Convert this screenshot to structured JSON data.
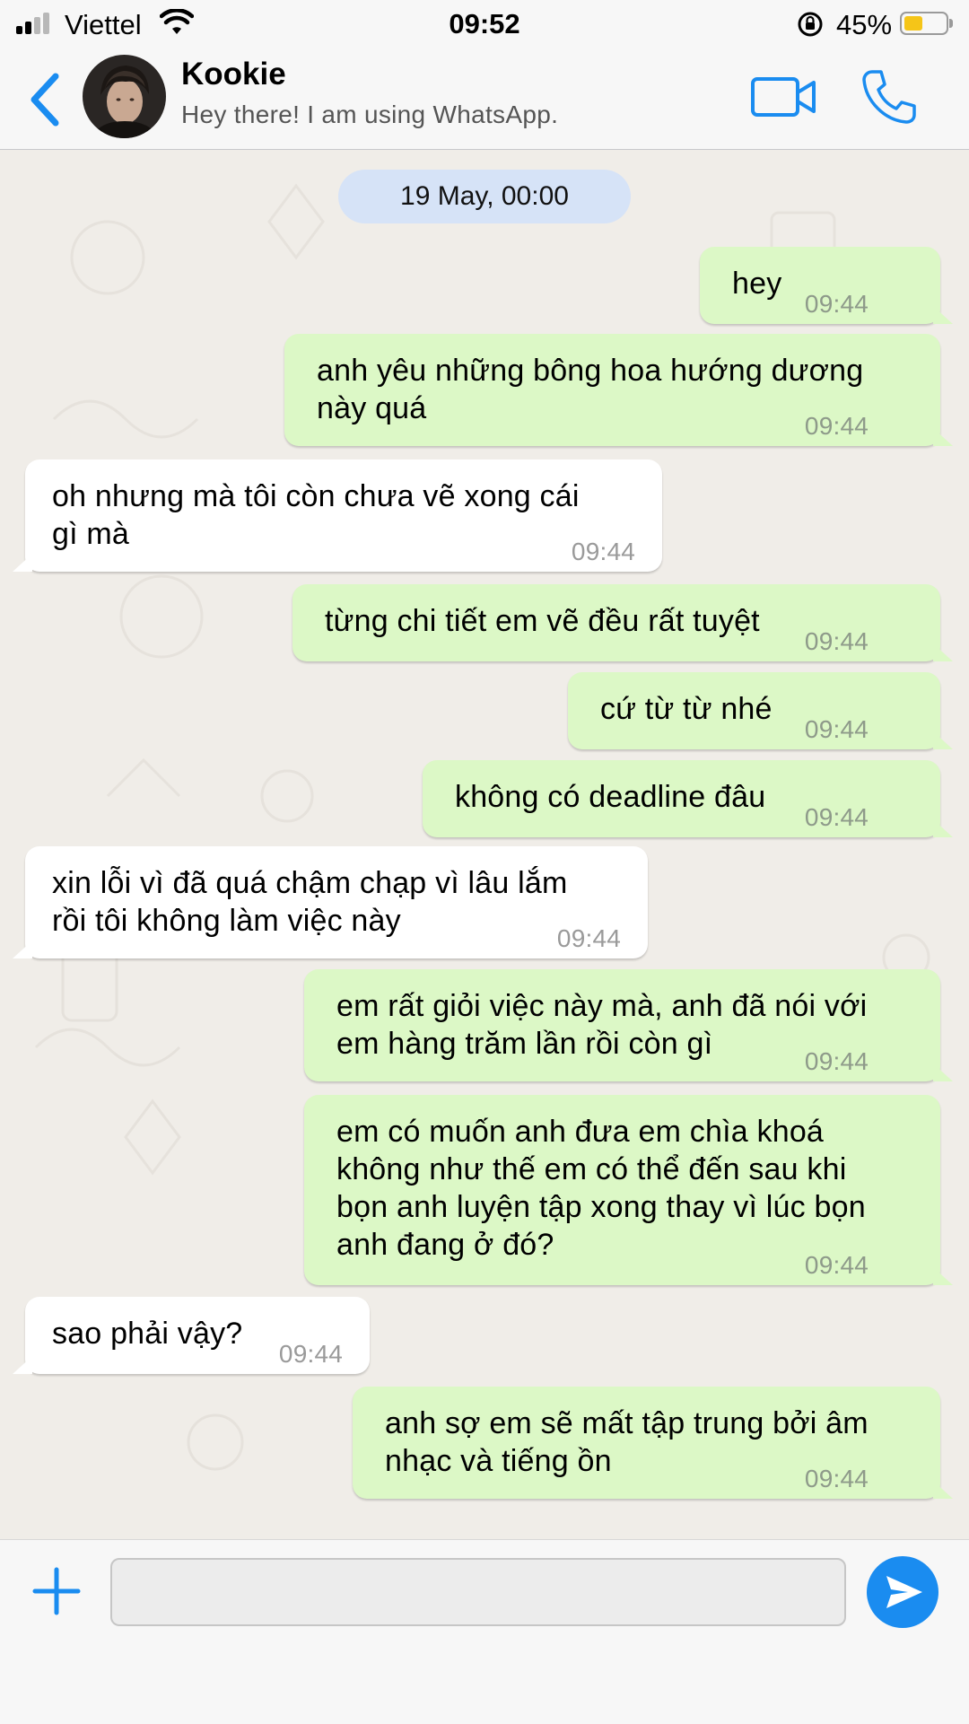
{
  "status_bar": {
    "carrier": "Viettel",
    "time": "09:52",
    "battery_percent": "45%",
    "battery_level": 0.45,
    "signal_bars": 2
  },
  "header": {
    "contact_name": "Kookie",
    "contact_status": "Hey there! I am using WhatsApp.",
    "back_icon": "chevron-left-icon",
    "video_icon": "video-camera-icon",
    "call_icon": "phone-icon"
  },
  "chat": {
    "date_label": "19 May, 00:00",
    "messages": [
      {
        "direction": "out",
        "text": "hey",
        "time": "09:44"
      },
      {
        "direction": "out",
        "text": "anh yêu những bông hoa hướng dương\nnày quá",
        "time": "09:44"
      },
      {
        "direction": "in",
        "text": "oh nhưng mà tôi còn chưa vẽ xong cái\ngì mà",
        "time": "09:44"
      },
      {
        "direction": "out",
        "text": "từng chi tiết em vẽ đều rất tuyệt",
        "time": "09:44"
      },
      {
        "direction": "out",
        "text": "cứ từ từ nhé",
        "time": "09:44"
      },
      {
        "direction": "out",
        "text": "không có deadline đâu",
        "time": "09:44"
      },
      {
        "direction": "in",
        "text": "xin lỗi vì đã quá chậm chạp vì lâu lắm\nrồi tôi không làm việc này",
        "time": "09:44"
      },
      {
        "direction": "out",
        "text": "em rất giỏi việc này mà, anh đã nói với\nem hàng trăm lần rồi còn gì",
        "time": "09:44"
      },
      {
        "direction": "out",
        "text": "em có muốn anh đưa em chìa khoá\nkhông như thế em có thể đến sau khi\nbọn anh luyện tập xong thay vì lúc bọn\nanh đang ở đó?",
        "time": "09:44"
      },
      {
        "direction": "in",
        "text": "sao phải vậy?",
        "time": "09:44"
      },
      {
        "direction": "out",
        "text": "anh sợ em sẽ mất tập trung bởi âm\nnhạc và tiếng ồn",
        "time": "09:44"
      }
    ]
  },
  "input_bar": {
    "placeholder": "",
    "plus_icon": "plus-icon",
    "send_icon": "send-icon"
  },
  "colors": {
    "accent": "#1a8cf0",
    "outgoing_bubble": "#dcf8c6",
    "incoming_bubble": "#ffffff",
    "date_pill": "#d6e3f7",
    "battery": "#f5c518"
  }
}
